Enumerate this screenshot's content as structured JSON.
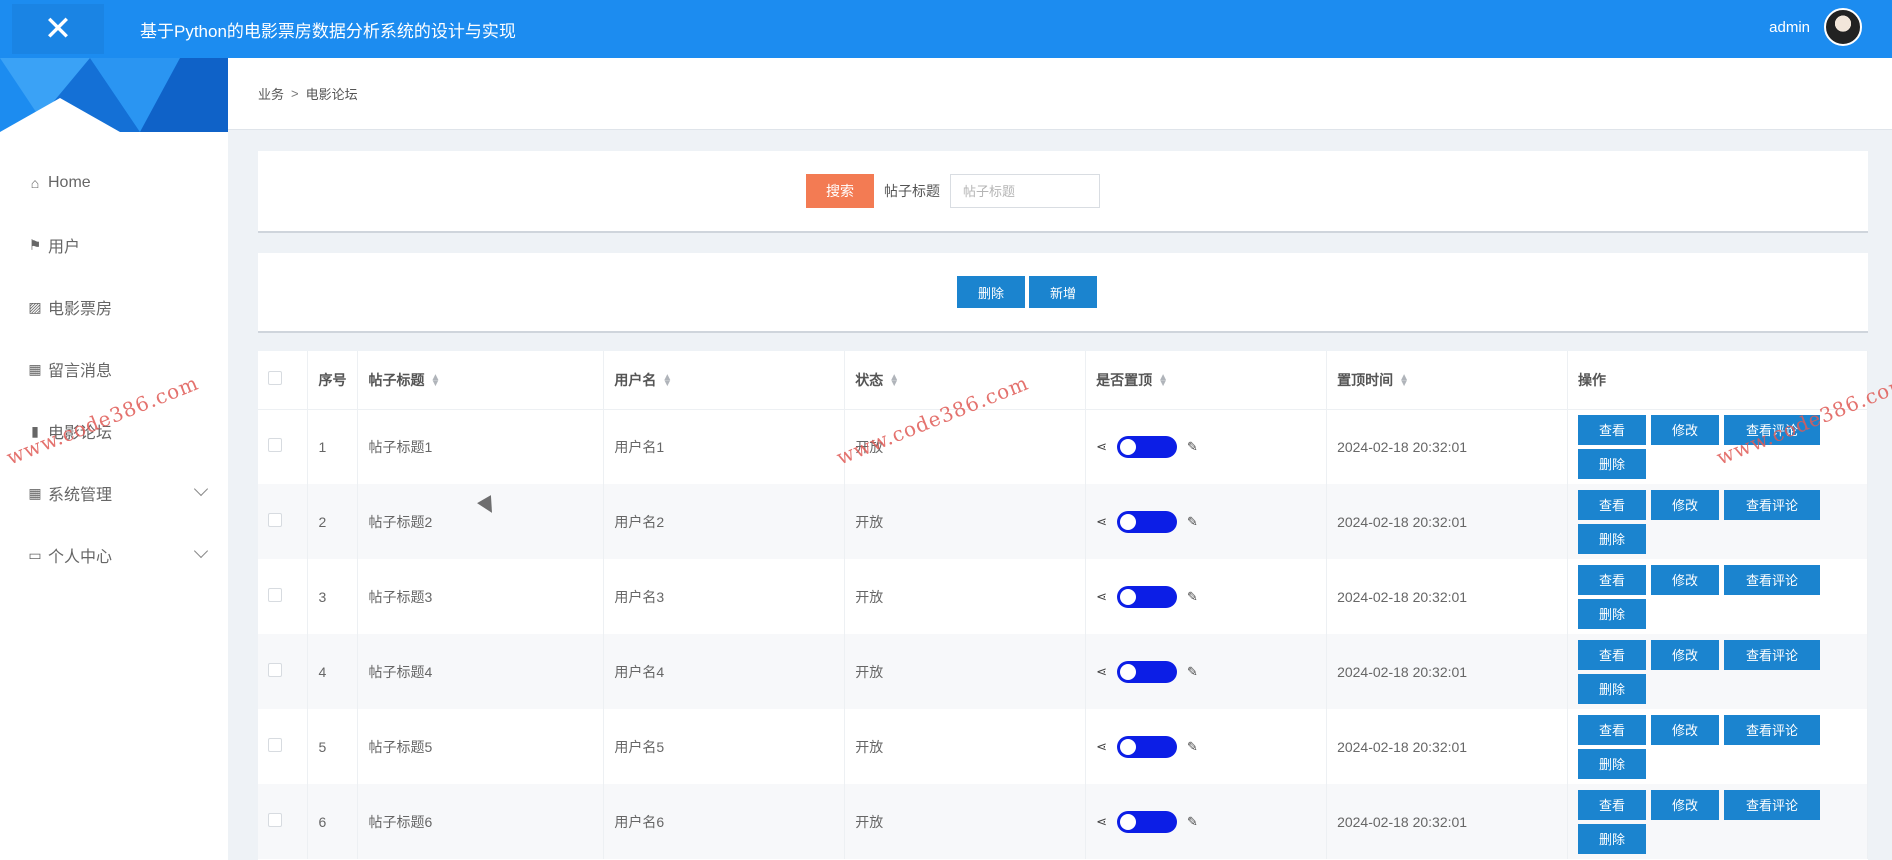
{
  "header": {
    "title": "基于Python的电影票房数据分析系统的设计与实现",
    "user": "admin",
    "close_icon": "close-icon",
    "accent": "#1c8cf0"
  },
  "sidebar": {
    "items": [
      {
        "label": "Home",
        "icon": "home-icon"
      },
      {
        "label": "用户",
        "icon": "flag-icon"
      },
      {
        "label": "电影票房",
        "icon": "chart-line-icon"
      },
      {
        "label": "留言消息",
        "icon": "grid-icon"
      },
      {
        "label": "电影论坛",
        "icon": "bar-chart-icon"
      },
      {
        "label": "系统管理",
        "icon": "grid-icon",
        "expandable": true
      },
      {
        "label": "个人中心",
        "icon": "card-icon",
        "expandable": true
      }
    ]
  },
  "breadcrumb": {
    "parent": "业务",
    "sep": ">",
    "current": "电影论坛"
  },
  "search": {
    "button": "搜索",
    "label": "帖子标题",
    "placeholder": "帖子标题",
    "value": ""
  },
  "actions": {
    "delete": "删除",
    "add": "新增"
  },
  "table": {
    "columns": [
      "序号",
      "帖子标题",
      "用户名",
      "状态",
      "是否置顶",
      "置顶时间",
      "操作"
    ],
    "rows": [
      {
        "index": "1",
        "title": "帖子标题1",
        "user": "用户名1",
        "status": "开放",
        "time": "2024-02-18 20:32:01"
      },
      {
        "index": "2",
        "title": "帖子标题2",
        "user": "用户名2",
        "status": "开放",
        "time": "2024-02-18 20:32:01"
      },
      {
        "index": "3",
        "title": "帖子标题3",
        "user": "用户名3",
        "status": "开放",
        "time": "2024-02-18 20:32:01"
      },
      {
        "index": "4",
        "title": "帖子标题4",
        "user": "用户名4",
        "status": "开放",
        "time": "2024-02-18 20:32:01"
      },
      {
        "index": "5",
        "title": "帖子标题5",
        "user": "用户名5",
        "status": "开放",
        "time": "2024-02-18 20:32:01"
      },
      {
        "index": "6",
        "title": "帖子标题6",
        "user": "用户名6",
        "status": "开放",
        "time": "2024-02-18 20:32:01"
      }
    ],
    "row_actions": {
      "view": "查看",
      "edit": "修改",
      "comments": "查看评论",
      "delete": "删除"
    }
  },
  "watermark": "www.code386.com"
}
